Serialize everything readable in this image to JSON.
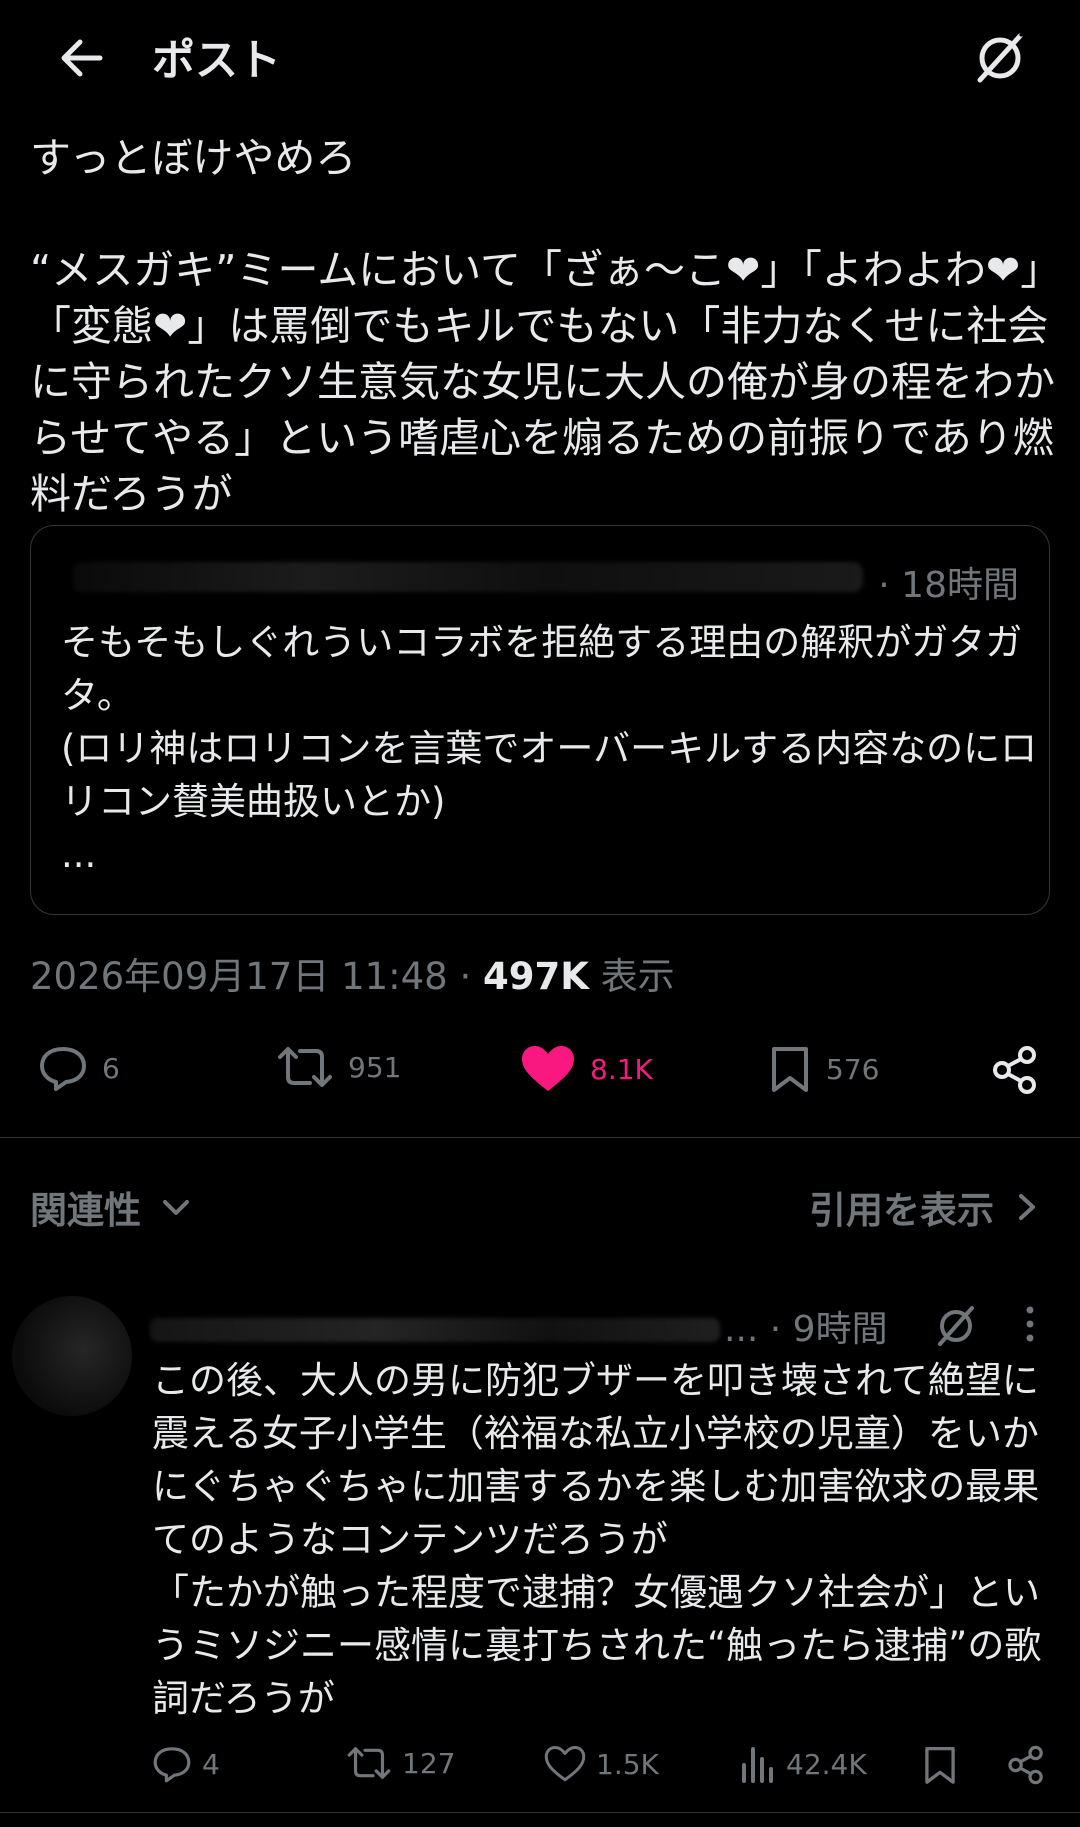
{
  "header": {
    "title": "ポスト"
  },
  "post": {
    "text": "すっとぼけやめろ\n\n“メスガキ”ミームにおいて「ざぁ〜こ❤」「よわよわ❤」「変態❤」は罵倒でもキルでもない「非力なくせに社会に守られたクソ生意気な女児に大人の俺が身の程をわからせてやる」という嗜虐心を煽るための前振りであり燃料だろうが",
    "quoted": {
      "time": "· 18時間",
      "text": "そもそもしぐれういコラボを拒絶する理由の解釈がガタガタ。\n(ロリ神はロリコンを言葉でオーバーキルする内容なのにロリコン賛美曲扱いとか)\n..."
    },
    "timestamp": "2026年09月17日 11:48 ·",
    "views": "497K",
    "views_label": "表示",
    "actions": {
      "replies": "6",
      "reposts": "951",
      "likes": "8.1K",
      "bookmarks": "576"
    }
  },
  "sort": {
    "label": "関連性",
    "quotes_link": "引用を表示"
  },
  "reply": {
    "name_suffix": "...",
    "time": "· 9時間",
    "text": "この後、大人の男に防犯ブザーを叩き壊されて絶望に震える女子小学生（裕福な私立小学校の児童）をいかにぐちゃぐちゃに加害するかを楽しむ加害欲求の最果てのようなコンテンツだろうが\n「たかが触った程度で逮捕？女優遇クソ社会が」というミソジニー感情に裏打ちされた“触ったら逮捕”の歌詞だろうが",
    "actions": {
      "replies": "4",
      "reposts": "127",
      "likes": "1.5K",
      "views": "42.4K"
    }
  },
  "colors": {
    "like_active": "#f91880",
    "muted": "#71767b",
    "text": "#e7e9ea",
    "background": "#000000"
  },
  "icons": [
    "back-arrow-icon",
    "grok-icon",
    "reply-icon",
    "repost-icon",
    "heart-icon",
    "bookmark-icon",
    "share-icon",
    "chevron-down-icon",
    "chevron-right-icon",
    "more-icon",
    "views-icon"
  ]
}
